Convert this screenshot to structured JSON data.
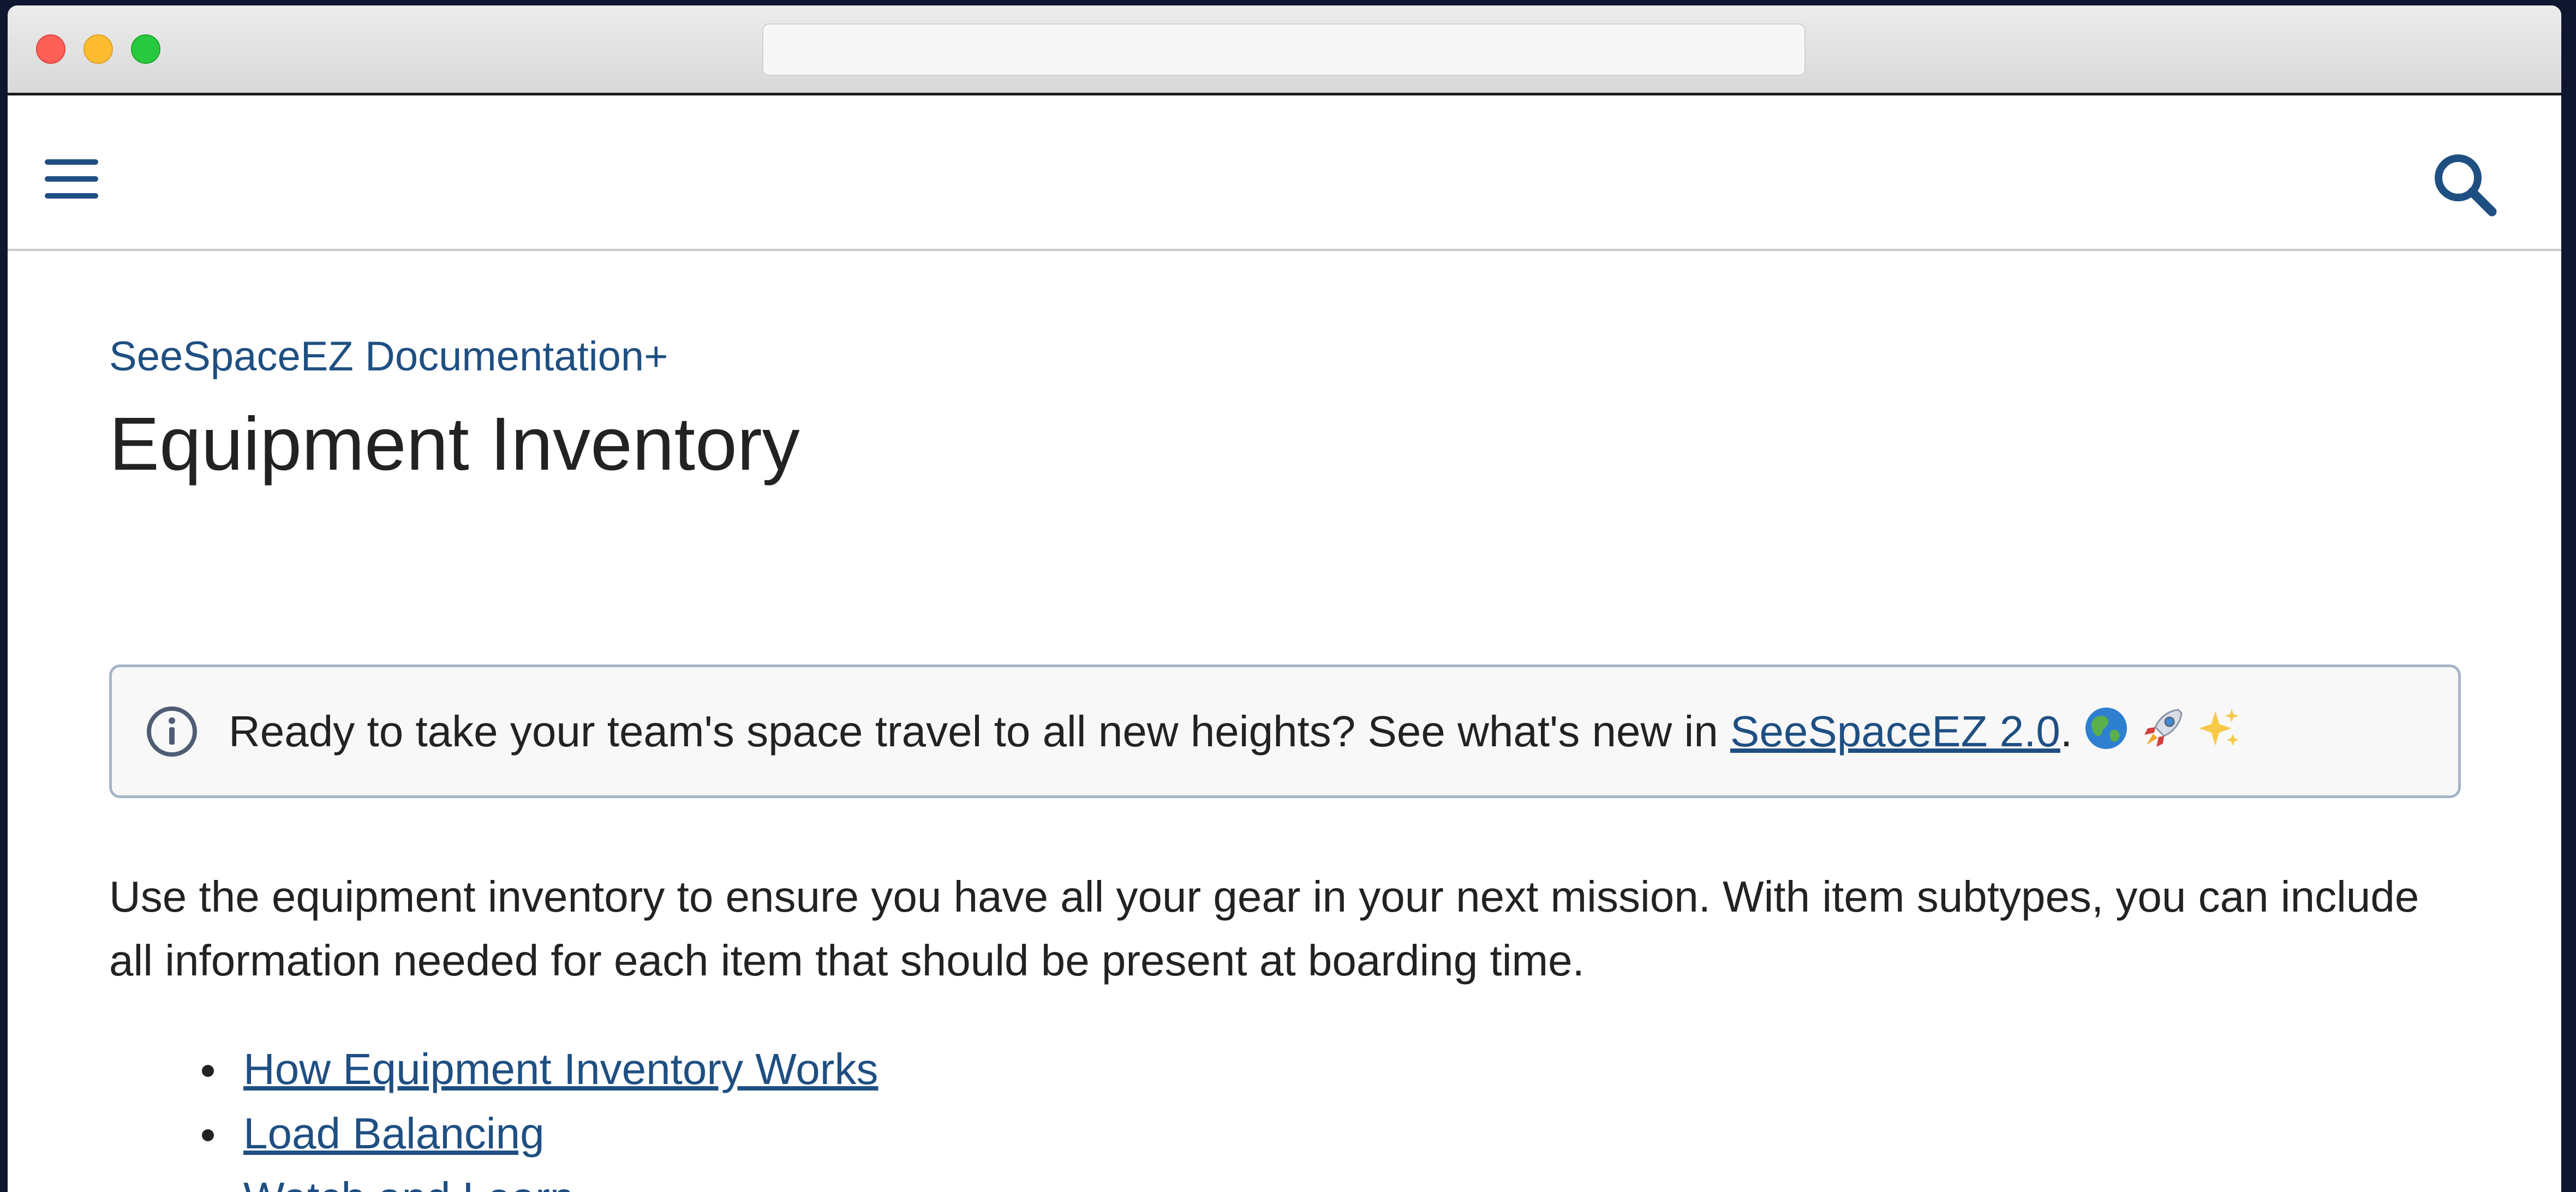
{
  "window": {
    "url": ""
  },
  "nav": {
    "menu_icon": "hamburger-menu-icon",
    "search_icon": "search-icon",
    "accent_color": "#1f4f82"
  },
  "breadcrumb": "SeeSpaceEZ Documentation+",
  "title": "Equipment Inventory",
  "info_banner": {
    "icon": "info-circle-icon",
    "text_before": "Ready to take your team's space travel to all new heights? See what's new in ",
    "link_text": "SeeSpaceEZ 2.0",
    "text_after": ".",
    "emojis": [
      "globe-icon",
      "rocket-icon",
      "sparkles-icon"
    ],
    "border_color": "#a6b4c8"
  },
  "intro": "Use the equipment inventory to ensure you have all your gear in your next mission. With item subtypes, you can include all information needed for each item that should be present at boarding time.",
  "toc": [
    {
      "label": "How Equipment Inventory Works"
    },
    {
      "label": "Load Balancing"
    },
    {
      "label": "Watch and Learn"
    }
  ]
}
